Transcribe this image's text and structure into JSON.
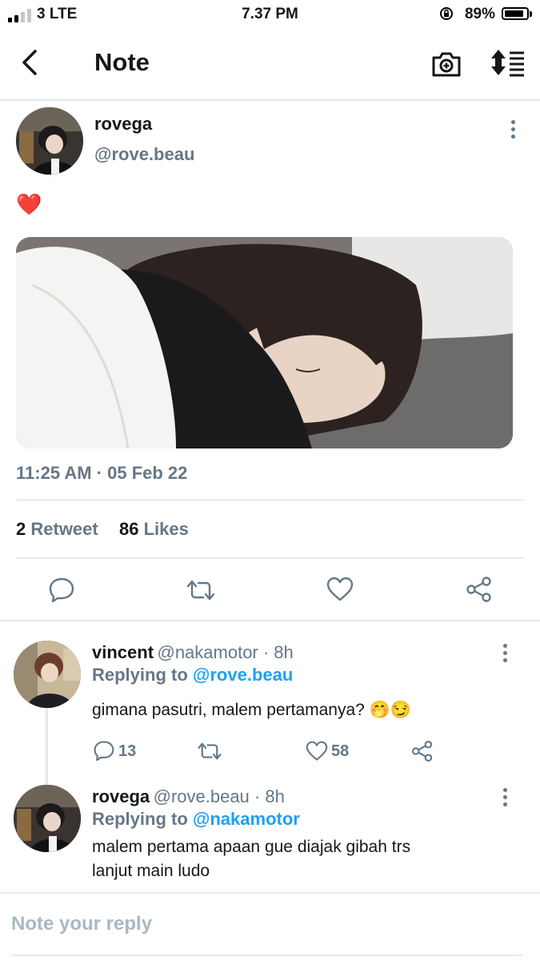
{
  "status_bar": {
    "carrier": "3  LTE",
    "time": "7.37 PM",
    "battery": "89%",
    "battery_level": 0.89,
    "signal_bars": 2,
    "signal_max": 4
  },
  "header": {
    "title": "Note",
    "back_icon": "chevron-left-icon",
    "camera_icon": "camera-plus-icon",
    "sort_icon": "sort-list-icon"
  },
  "post": {
    "name": "rovega",
    "handle": "@rove.beau",
    "content": "❤️",
    "image_alt": "photo of a person sleeping under a white blanket on a gray pillow",
    "timestamp": "11:25 AM · 05 Feb 22",
    "retweet_count": "2",
    "retweet_label": "Retweet",
    "like_count": "86",
    "like_label": "Likes",
    "actions": [
      "reply-icon",
      "retweet-icon",
      "like-icon",
      "share-icon"
    ]
  },
  "replies": [
    {
      "name": "vincent",
      "handle": "@nakamotor · 8h",
      "replying_prefix": "Replying to",
      "replying_to": "@rove.beau",
      "text": "gimana pasutri, malem pertamanya? 🤭😏",
      "reply_count": "13",
      "retweet_count": "",
      "like_count": "58"
    },
    {
      "name": "rovega",
      "handle": "@rove.beau · 8h",
      "replying_prefix": "Replying to",
      "replying_to": "@nakamotor",
      "text_line1": "malem pertama apaan gue diajak gibah trs",
      "text_line2": "lanjut main ludo"
    }
  ],
  "composer": {
    "placeholder": "Note your reply"
  },
  "colors": {
    "accent": "#1da1f2",
    "muted": "#657786",
    "text": "#14171a",
    "divider": "#e6ecf0"
  }
}
